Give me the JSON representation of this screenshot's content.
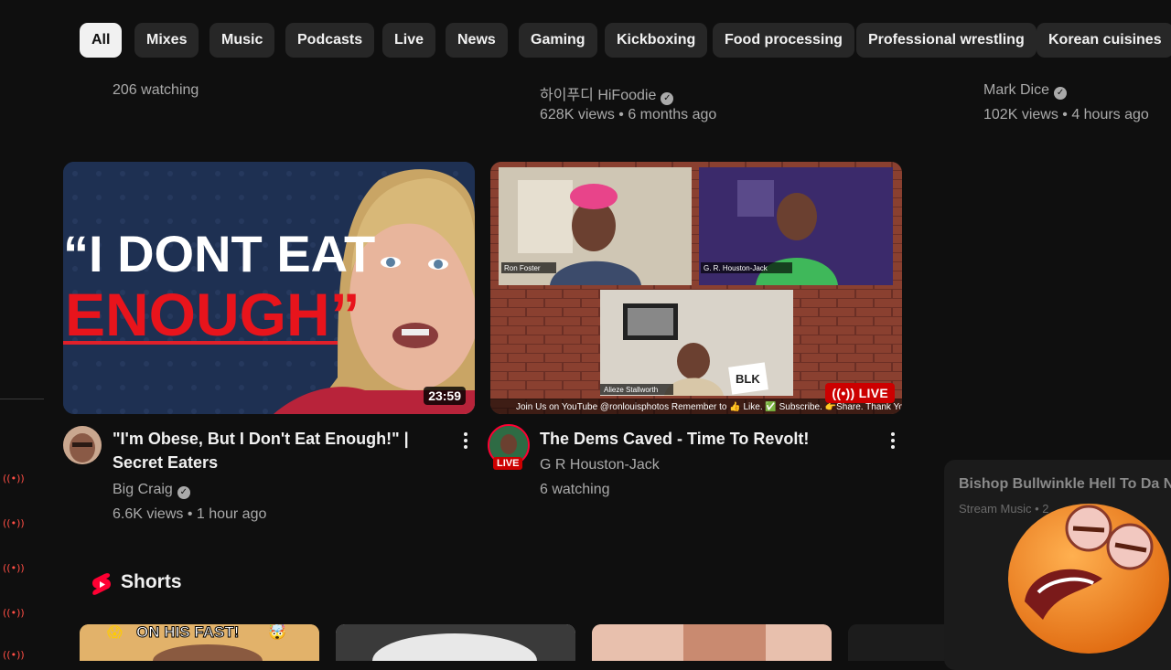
{
  "chips": [
    {
      "label": "All",
      "active": true
    },
    {
      "label": "Mixes"
    },
    {
      "label": "Music"
    },
    {
      "label": "Podcasts"
    },
    {
      "label": "Live"
    },
    {
      "label": "News"
    },
    {
      "label": "Gaming"
    },
    {
      "label": "Kickboxing"
    },
    {
      "label": "Food processing"
    },
    {
      "label": "Professional wrestling"
    },
    {
      "label": "Korean cuisines"
    }
  ],
  "top_row": {
    "left": {
      "meta": "206 watching"
    },
    "middle": {
      "channel": "하이푸디 HiFoodie",
      "meta": "628K views • 6 months ago"
    },
    "right": {
      "channel": "Mark Dice",
      "meta": "102K views • 4 hours ago"
    }
  },
  "videos": [
    {
      "thumb_line1": "“I DONT EAT",
      "thumb_line2": "ENOUGH”",
      "duration": "23:59",
      "title": "\"I'm Obese, But I Don't Eat Enough!\" | Secret Eaters",
      "channel": "Big Craig",
      "meta": "6.6K views • 1 hour ago"
    },
    {
      "live_badge": "LIVE",
      "avatar_badge": "LIVE",
      "name_tag_1": "Ron Foster",
      "name_tag_2": "G. R. Houston-Jack",
      "name_tag_3": "Alieze Stallworth",
      "sign_text": "BLK",
      "banner": "Join Us on YouTube @ronlouisphotos Remember to 👍 Like. ✅ Subscribe. 👉Share. Thank You!",
      "title": "The Dems Caved - Time To Revolt!",
      "channel": "G R Houston-Jack",
      "meta": "6 watching"
    }
  ],
  "shorts": {
    "label": "Shorts",
    "first_caption": "ON HIS FAST!"
  },
  "mini_player": {
    "title": "Bishop Bullwinkle Hell To Da Naw",
    "subtitle": "Stream Music • 2"
  },
  "colors": {
    "accent_red": "#ff0033",
    "background": "#0f0f0f",
    "chip": "#272727"
  }
}
